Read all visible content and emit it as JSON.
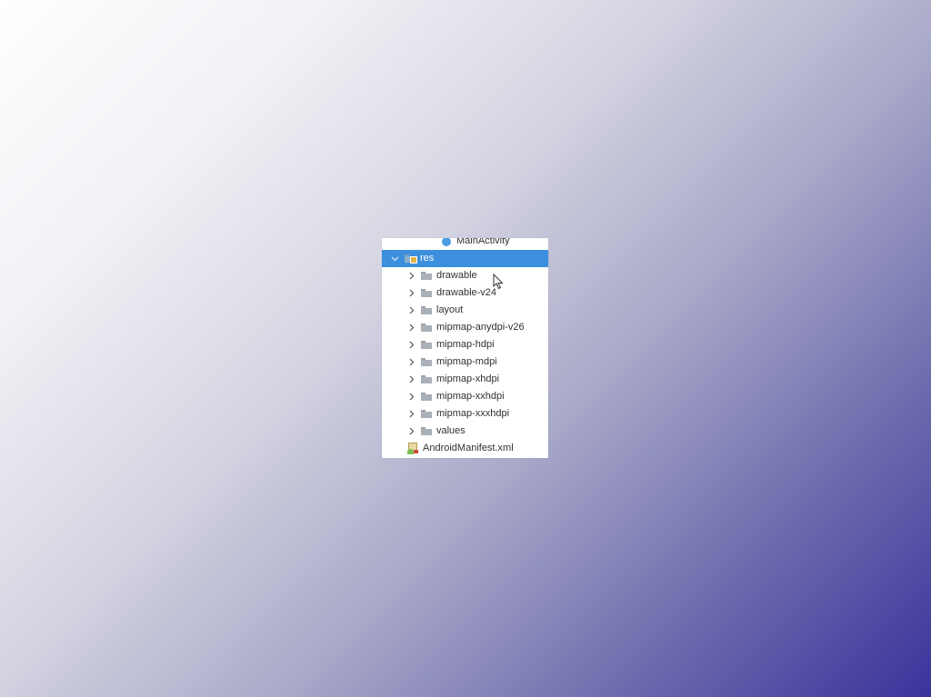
{
  "project_tree": {
    "partial_item": {
      "label": "MainActivity",
      "icon": "class-icon"
    },
    "res_folder": {
      "label": "res",
      "expanded": true,
      "selected": true,
      "icon": "resource-folder-icon"
    },
    "children": [
      {
        "label": "drawable",
        "icon": "folder-icon"
      },
      {
        "label": "drawable-v24",
        "icon": "folder-icon"
      },
      {
        "label": "layout",
        "icon": "folder-icon"
      },
      {
        "label": "mipmap-anydpi-v26",
        "icon": "folder-icon"
      },
      {
        "label": "mipmap-hdpi",
        "icon": "folder-icon"
      },
      {
        "label": "mipmap-mdpi",
        "icon": "folder-icon"
      },
      {
        "label": "mipmap-xhdpi",
        "icon": "folder-icon"
      },
      {
        "label": "mipmap-xxhdpi",
        "icon": "folder-icon"
      },
      {
        "label": "mipmap-xxxhdpi",
        "icon": "folder-icon"
      },
      {
        "label": "values",
        "icon": "folder-icon"
      }
    ],
    "manifest": {
      "label": "AndroidManifest.xml",
      "icon": "manifest-file-icon"
    }
  },
  "colors": {
    "selection": "#3c8fdc",
    "background_start": "#ffffff",
    "background_end": "#3a339c"
  }
}
